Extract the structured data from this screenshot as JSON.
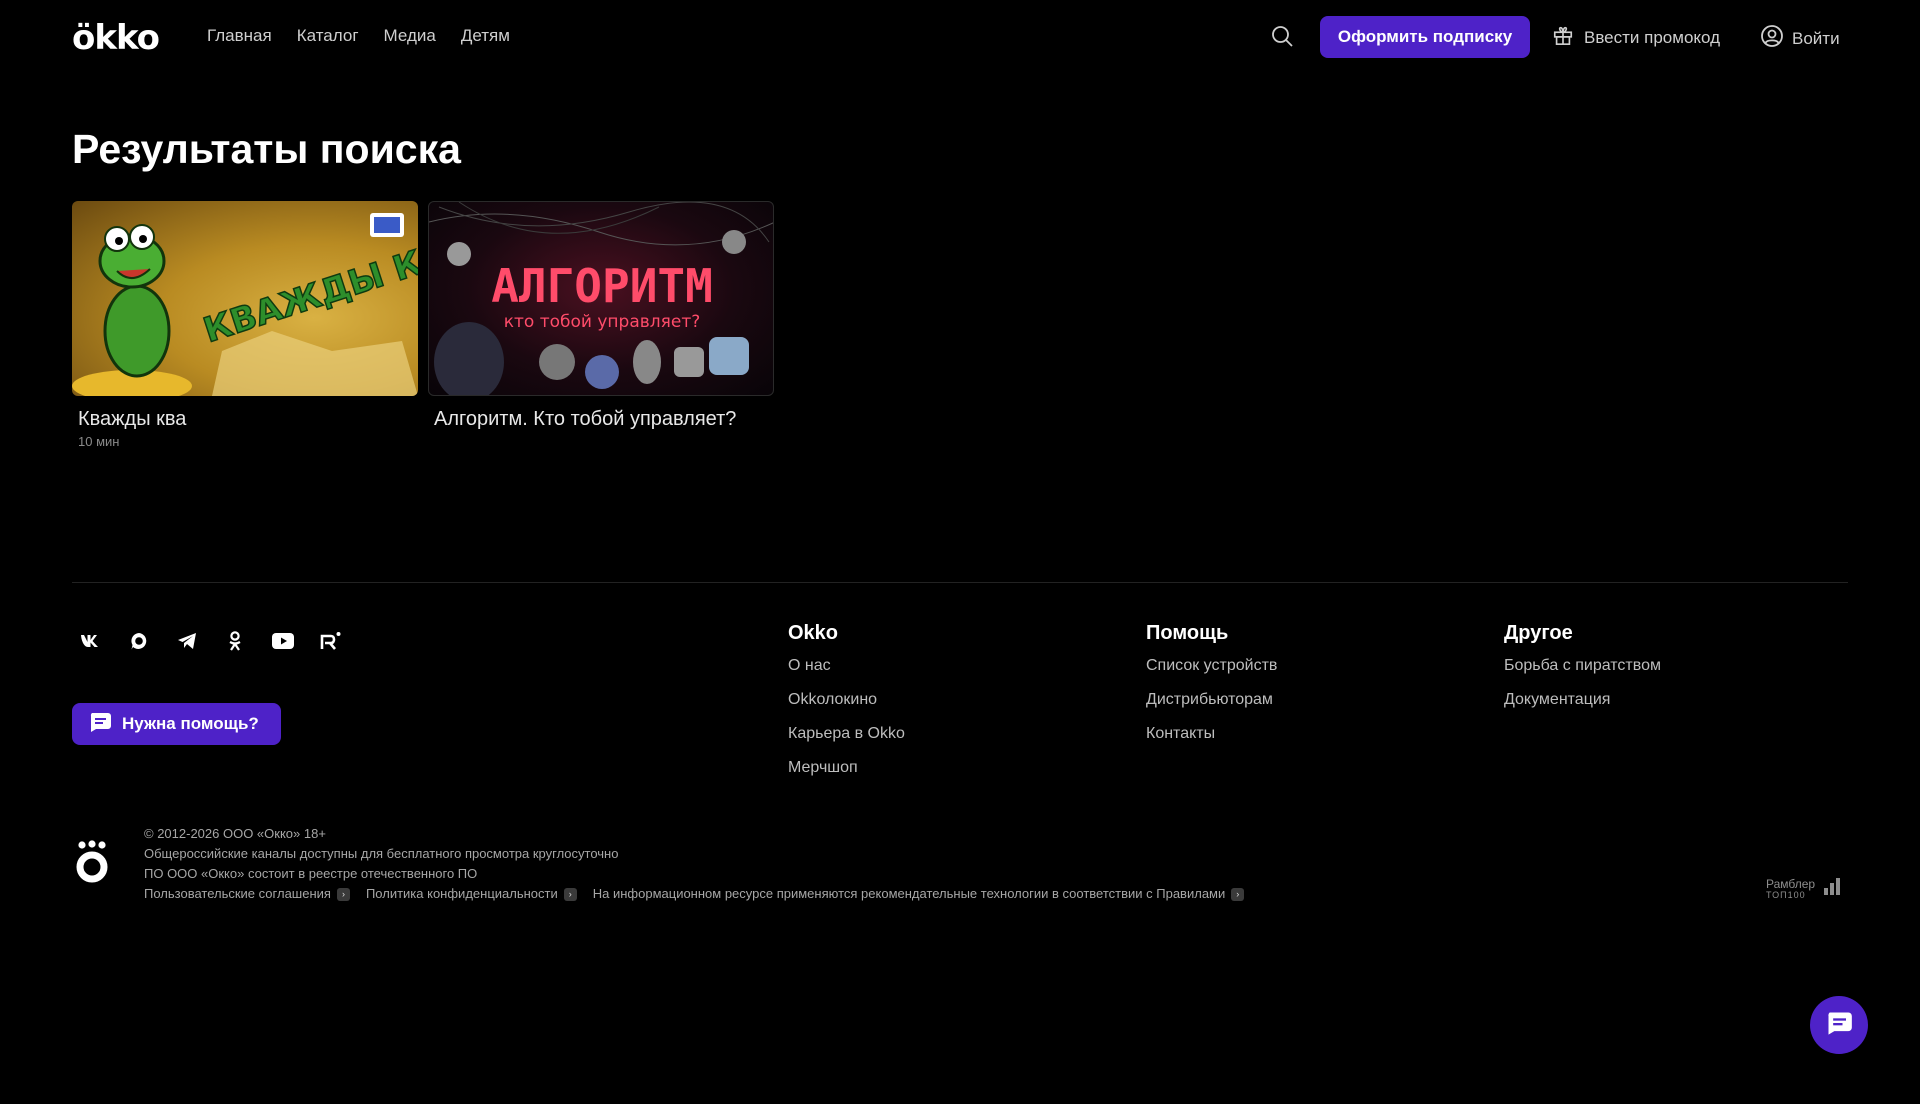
{
  "header": {
    "logo": "ökko",
    "nav": [
      "Главная",
      "Каталог",
      "Медиа",
      "Детям"
    ],
    "subscribe_label": "Оформить подписку",
    "promo_label": "Ввести промокод",
    "login_label": "Войти"
  },
  "main": {
    "title": "Результаты поиска",
    "cards": [
      {
        "title": "Кважды ква",
        "meta": "10 мин",
        "thumb_text": "КВАЖДЫ КВА"
      },
      {
        "title": "Алгоритм. Кто тобой управляет?",
        "meta": "",
        "thumb_text": "АЛГОРИТМ",
        "thumb_subtext": "кто тобой управляет?"
      }
    ]
  },
  "footer": {
    "socials": [
      "vk-icon",
      "max-icon",
      "telegram-icon",
      "odnoklassniki-icon",
      "youtube-icon",
      "rutube-icon"
    ],
    "help_label": "Нужна помощь?",
    "columns": [
      {
        "title": "Okko",
        "links": [
          "О нас",
          "Okkолокино",
          "Карьера в Okko",
          "Мерчшоп"
        ]
      },
      {
        "title": "Помощь",
        "links": [
          "Список устройств",
          "Дистрибьюторам",
          "Контакты"
        ]
      },
      {
        "title": "Другое",
        "links": [
          "Борьба с пиратством",
          "Документация"
        ]
      }
    ],
    "legal": {
      "line1": "© 2012-2026 ООО «Окко» 18+",
      "line2": "Общероссийские каналы доступны для бесплатного просмотра круглосуточно",
      "line3": "ПО ООО «Окко» состоит в реестре отечественного ПО",
      "links": [
        "Пользовательские соглашения",
        "Политика конфиденциальности",
        "На информационном ресурсе применяются рекомендательные технологии в соответствии с Правилами"
      ]
    },
    "rambler": {
      "name": "Рамблер",
      "top": "ТОП100"
    }
  },
  "colors": {
    "accent": "#4e22c8",
    "background": "#000000"
  }
}
